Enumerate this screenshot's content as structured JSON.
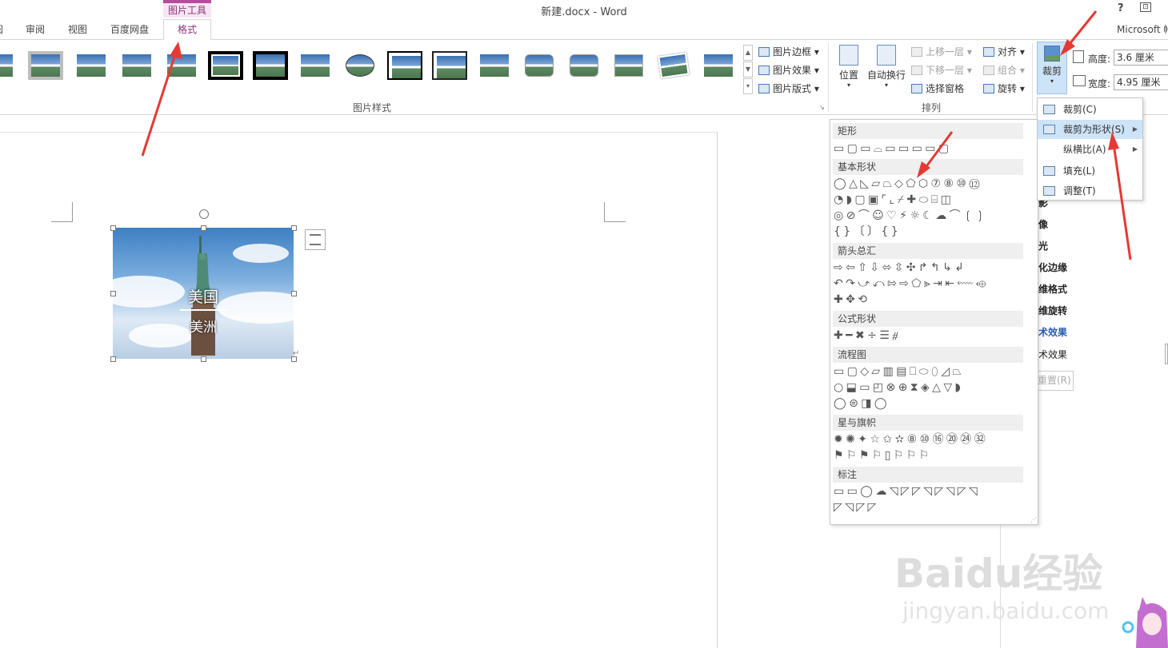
{
  "title_bar": {
    "context_group": "图片工具",
    "doc_title": "新建.docx - Word",
    "help": "?",
    "restore": "⊡",
    "account": "Microsoft 帐"
  },
  "tabs": {
    "partial": "阅",
    "review": "审阅",
    "view": "视图",
    "baidu": "百度网盘",
    "format": "格式"
  },
  "ribbon": {
    "picture_styles_label": "图片样式",
    "border": "图片边框 ▾",
    "effects": "图片效果 ▾",
    "layout": "图片版式 ▾",
    "position": "位置",
    "position_arrow": "▾",
    "wrap": "自动换行",
    "wrap_arrow": "▾",
    "bring_forward": "上移一层 ▾",
    "send_backward": "下移一层 ▾",
    "selection_pane": "选择窗格",
    "align": "对齐 ▾",
    "group": "组合 ▾",
    "rotate": "旋转 ▾",
    "arrange_label": "排列",
    "crop": "裁剪",
    "crop_arrow": "▾",
    "height_label": "高度:",
    "height_value": "3.6 厘米",
    "width_label": "宽度:",
    "width_value": "4.95 厘米"
  },
  "image": {
    "text1": "美国",
    "text2": "美洲"
  },
  "crop_menu": {
    "crop": "裁剪(C)",
    "crop_to_shape": "裁剪为形状(S)",
    "aspect_ratio": "纵横比(A)",
    "fill": "填充(L)",
    "fit": "调整(T)"
  },
  "shape_menu": {
    "rect": {
      "title": "矩形",
      "rows": [
        "▭▢▭⌓▭▭▭▭▢"
      ]
    },
    "basic": {
      "title": "基本形状",
      "rows": [
        "◯△◺▱⏢◇⬠⬡⑦⑧⑩⑫",
        "◔◗▢▣⌜⌞⌿✚⬭⌸◫",
        "◎⊘⌒☺♡⚡☼☾☁⌒❲❳",
        "{}〔〕{}"
      ]
    },
    "arrows": {
      "title": "箭头总汇",
      "rows": [
        "⇨⇦⇧⇩⬄⇳✣↱↰↳↲",
        "↶↷⤻⤺⇰⇨⬠⪢⇥⇤⬳⬲",
        "✚✥⟲"
      ]
    },
    "equation": {
      "title": "公式形状",
      "rows": [
        "✚━✖÷☰⧣"
      ]
    },
    "flowchart": {
      "title": "流程图",
      "rows": [
        "▭▢◇▱▥▤⎕⬭⬯◿⏢",
        "○⬓▭◰⊗⊕⧗◈△▽◗",
        "◯⊜◨◯"
      ]
    },
    "stars": {
      "title": "星与旗帜",
      "rows": [
        "✹✺✦☆✩✫⑧⑩⑯⑳㉔㉜",
        "⚑⚐⚑⚐▯⚐⚐⚐"
      ]
    },
    "callouts": {
      "title": "标注",
      "rows": [
        "▭▭◯☁◹◸◸◹◸◹◸◹",
        "◸◹◸◸"
      ]
    }
  },
  "right_pane": {
    "items": [
      "影",
      "像",
      "光",
      "化边缘",
      "维格式",
      "维旋转",
      "术效果",
      "术效果"
    ],
    "reset": "重置(R)"
  },
  "watermark": {
    "logo": "Baidu经验",
    "url": "jingyan.baidu.com"
  },
  "colors": {
    "accent": "#b84b9d",
    "highlight": "#cde3f7",
    "arrow": "#e53935"
  }
}
